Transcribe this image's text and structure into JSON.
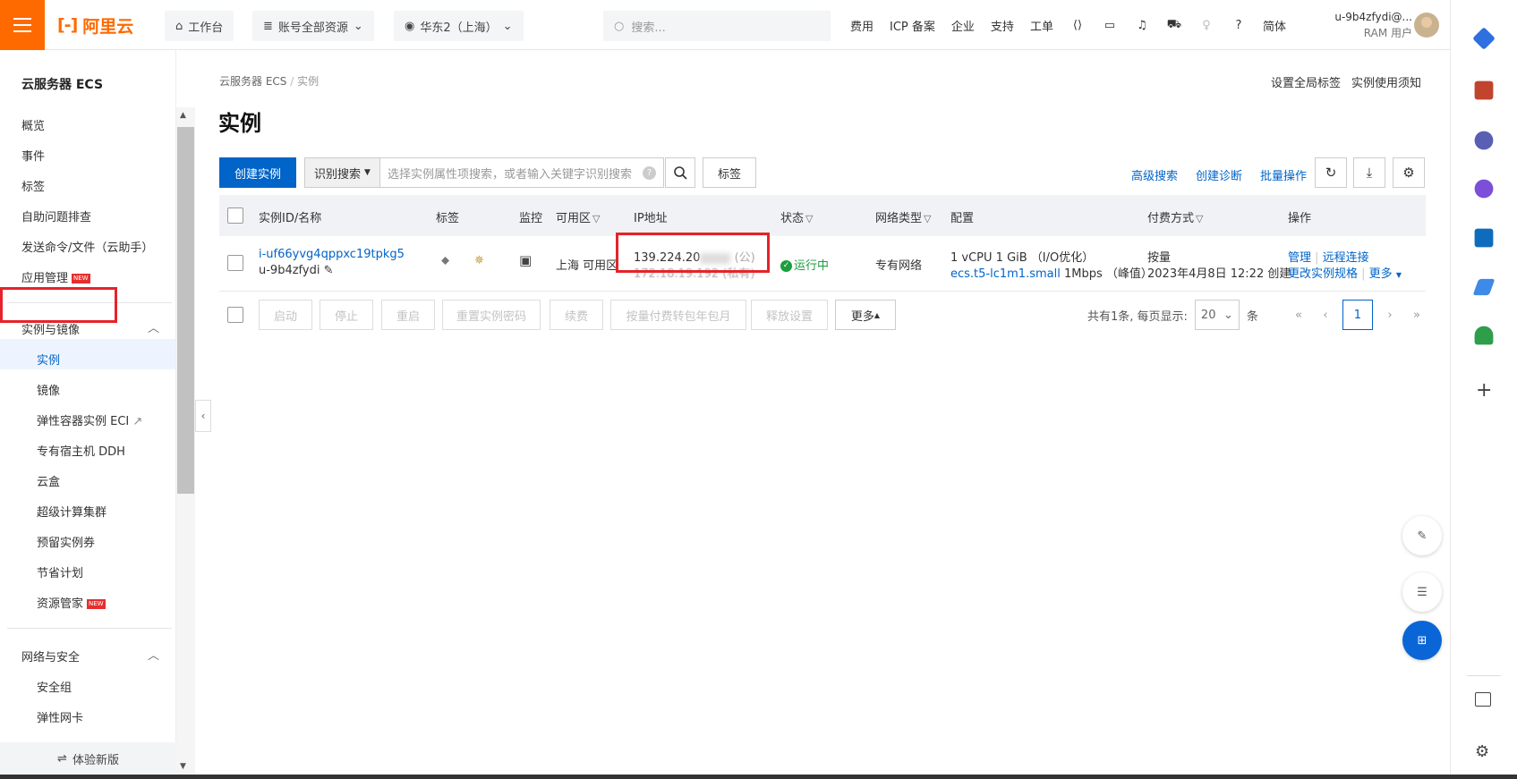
{
  "topbar": {
    "logo_text": "阿里云",
    "workbench": "工作台",
    "resources": "账号全部资源",
    "region": "华东2（上海）",
    "search_placeholder": "搜索...",
    "links": [
      "费用",
      "ICP 备案",
      "企业",
      "支持",
      "工单"
    ],
    "lang": "简体",
    "user_name": "u-9b4zfydi@...",
    "user_role": "RAM 用户"
  },
  "sidebar": {
    "title": "云服务器 ECS",
    "items": [
      "概览",
      "事件",
      "标签",
      "自助问题排查",
      "发送命令/文件（云助手）",
      "应用管理"
    ],
    "new_badge": "NEW",
    "group1": "实例与镜像",
    "group1_items": [
      "实例",
      "镜像",
      "弹性容器实例 ECI",
      "专有宿主机 DDH",
      "云盒",
      "超级计算集群",
      "预留实例券",
      "节省计划",
      "资源管家"
    ],
    "group2": "网络与安全",
    "group2_items": [
      "安全组",
      "弹性网卡"
    ],
    "footer": "体验新版"
  },
  "main": {
    "breadcrumb_root": "云服务器 ECS",
    "breadcrumb_current": "实例",
    "top_right_links": [
      "设置全局标签",
      "实例使用须知"
    ],
    "title": "实例",
    "create_button": "创建实例",
    "search_type": "识别搜索",
    "search_placeholder": "选择实例属性项搜索，或者输入关键字识别搜索",
    "tag_button": "标签",
    "right_actions": [
      "高级搜索",
      "创建诊断",
      "批量操作"
    ]
  },
  "table": {
    "headers": {
      "id": "实例ID/名称",
      "tag": "标签",
      "monitor": "监控",
      "zone": "可用区",
      "ip": "IP地址",
      "status": "状态",
      "net": "网络类型",
      "config": "配置",
      "pay": "付费方式",
      "ops": "操作"
    },
    "row": {
      "id": "i-uf66yvg4qppxc19tpkg5",
      "name": "u-9b4zfydi",
      "zone": "上海 可用区",
      "ip_public": "139.224.20",
      "ip_public_tag": "(公)",
      "ip_private": "172.18.19.192",
      "ip_private_tag": "(私有)",
      "status": "运行中",
      "net": "专有网络",
      "config_line1": "1 vCPU 1 GiB （I/O优化）",
      "config_spec": "ecs.t5-lc1m1.small",
      "config_bw": "1Mbps （峰值）",
      "pay_type": "按量",
      "pay_created": "2023年4月8日 12:22 创建",
      "op_manage": "管理",
      "op_remote": "远程连接",
      "op_change": "更改实例规格",
      "op_more": "更多"
    }
  },
  "actions": {
    "buttons": [
      "启动",
      "停止",
      "重启",
      "重置实例密码",
      "续费",
      "按量付费转包年包月",
      "释放设置"
    ],
    "more": "更多",
    "total": "共有1条, 每页显示:",
    "page_size": "20",
    "unit": "条",
    "current_page": "1"
  }
}
